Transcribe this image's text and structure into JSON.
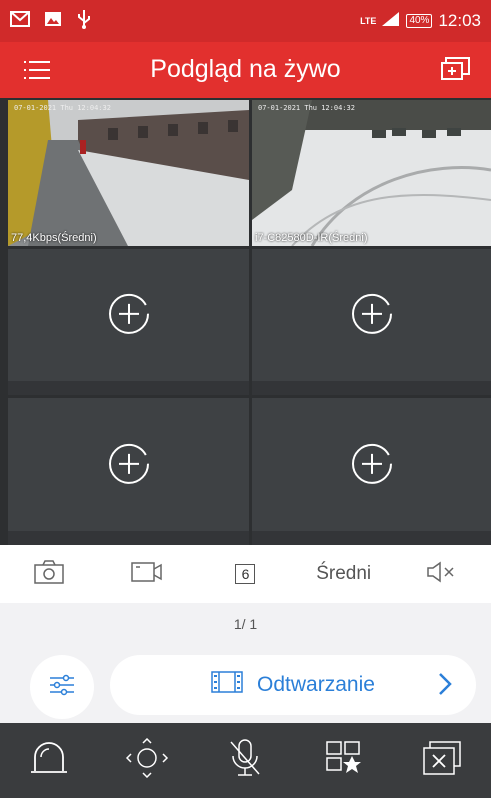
{
  "status_bar": {
    "icons": [
      "gmail-icon",
      "image-icon",
      "usb-icon"
    ],
    "network": "LTE",
    "battery": "40%",
    "time": "12:03"
  },
  "app_bar": {
    "title": "Podgląd na żywo",
    "menu_icon": "menu-icon",
    "add_window_icon": "add-window-icon"
  },
  "live_grid": {
    "tiles": [
      {
        "label": "77,4Kbps(Średni)",
        "osd": "07-01-2021 Thu 12:04:32",
        "has_video": true
      },
      {
        "label": "i7-C82580D-IR(Średni)",
        "osd": "07-01-2021 Thu 12:04:32",
        "has_video": true
      },
      {
        "label": "",
        "has_video": false
      },
      {
        "label": "",
        "has_video": false
      },
      {
        "label": "",
        "has_video": false
      },
      {
        "label": "",
        "has_video": false
      }
    ]
  },
  "toolbar": {
    "snapshot_icon": "camera-icon",
    "record_icon": "video-record-icon",
    "window_count": "6",
    "quality": "Średni",
    "audio_icon": "speaker-muted-icon"
  },
  "paging": {
    "indicator": "1/ 1"
  },
  "controls": {
    "settings_icon": "sliders-icon",
    "playback_label": "Odtwarzanie",
    "playback_icon": "film-icon",
    "chevron_icon": "chevron-right-icon"
  },
  "bottom_bar": {
    "items": [
      "alarm-light-icon",
      "ptz-control-icon",
      "mic-muted-icon",
      "favorites-icon",
      "close-all-icon"
    ]
  },
  "colors": {
    "brand_red": "#e2302e",
    "status_red": "#d02a2a",
    "accent_blue": "#2b7fd8",
    "grid_bg": "#3e4144"
  }
}
